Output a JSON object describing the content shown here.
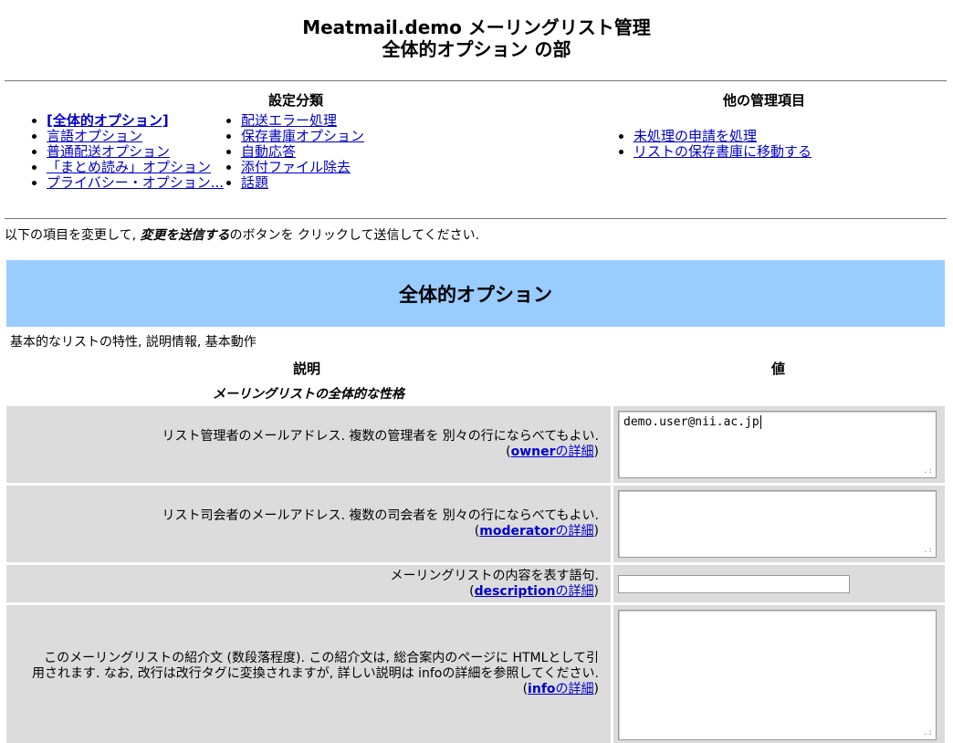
{
  "header": {
    "title_line1": "Meatmail.demo メーリングリスト管理",
    "title_line2": "全体的オプション の部"
  },
  "nav": {
    "settings_heading": "設定分類",
    "settings_col1": [
      {
        "label": "[全体的オプション]",
        "current": true
      },
      {
        "label": "言語オプション"
      },
      {
        "label": "普通配送オプション"
      },
      {
        "label": "「まとめ読み」オプション"
      },
      {
        "label": "プライバシー・オプション..."
      }
    ],
    "settings_col2": [
      {
        "label": "配送エラー処理"
      },
      {
        "label": "保存書庫オプション"
      },
      {
        "label": "自動応答"
      },
      {
        "label": "添付ファイル除去"
      },
      {
        "label": "話題"
      }
    ],
    "other_heading": "他の管理項目",
    "other_items": [
      {
        "label": "未処理の申請を処理"
      },
      {
        "label": "リストの保存書庫に移動する"
      }
    ]
  },
  "instruction": {
    "prefix": "以下の項目を変更して, ",
    "emphasis": "変更を送信する",
    "suffix": "のボタンを クリックして送信してください."
  },
  "section": {
    "title": "全体的オプション",
    "description": "基本的なリストの特性, 説明情報, 基本動作",
    "col_description": "説明",
    "col_value": "値",
    "category": "メーリングリストの全体的な性格"
  },
  "options": [
    {
      "desc": "リスト管理者のメールアドレス. 複数の管理者を 別々の行にならべてもよい.",
      "link_name": "owner",
      "link_suffix": "の詳細",
      "value": "demo.user@nii.ac.jp"
    },
    {
      "desc": "リスト司会者のメールアドレス. 複数の司会者を 別々の行にならべてもよい.",
      "link_name": "moderator",
      "link_suffix": "の詳細",
      "value": ""
    },
    {
      "desc": "メーリングリストの内容を表す語句.",
      "link_name": "description",
      "link_suffix": "の詳細",
      "value": ""
    },
    {
      "desc_line1": "このメーリングリストの紹介文 (数段落程度). この紹介文は, 総合案内のページに HTMLとして引",
      "desc_line2": "用されます. なお, 改行は改行タグに変換されますが, 詳しい説明は infoの詳細を参照してください.",
      "link_name": "info",
      "link_suffix": "の詳細",
      "value": ""
    }
  ]
}
